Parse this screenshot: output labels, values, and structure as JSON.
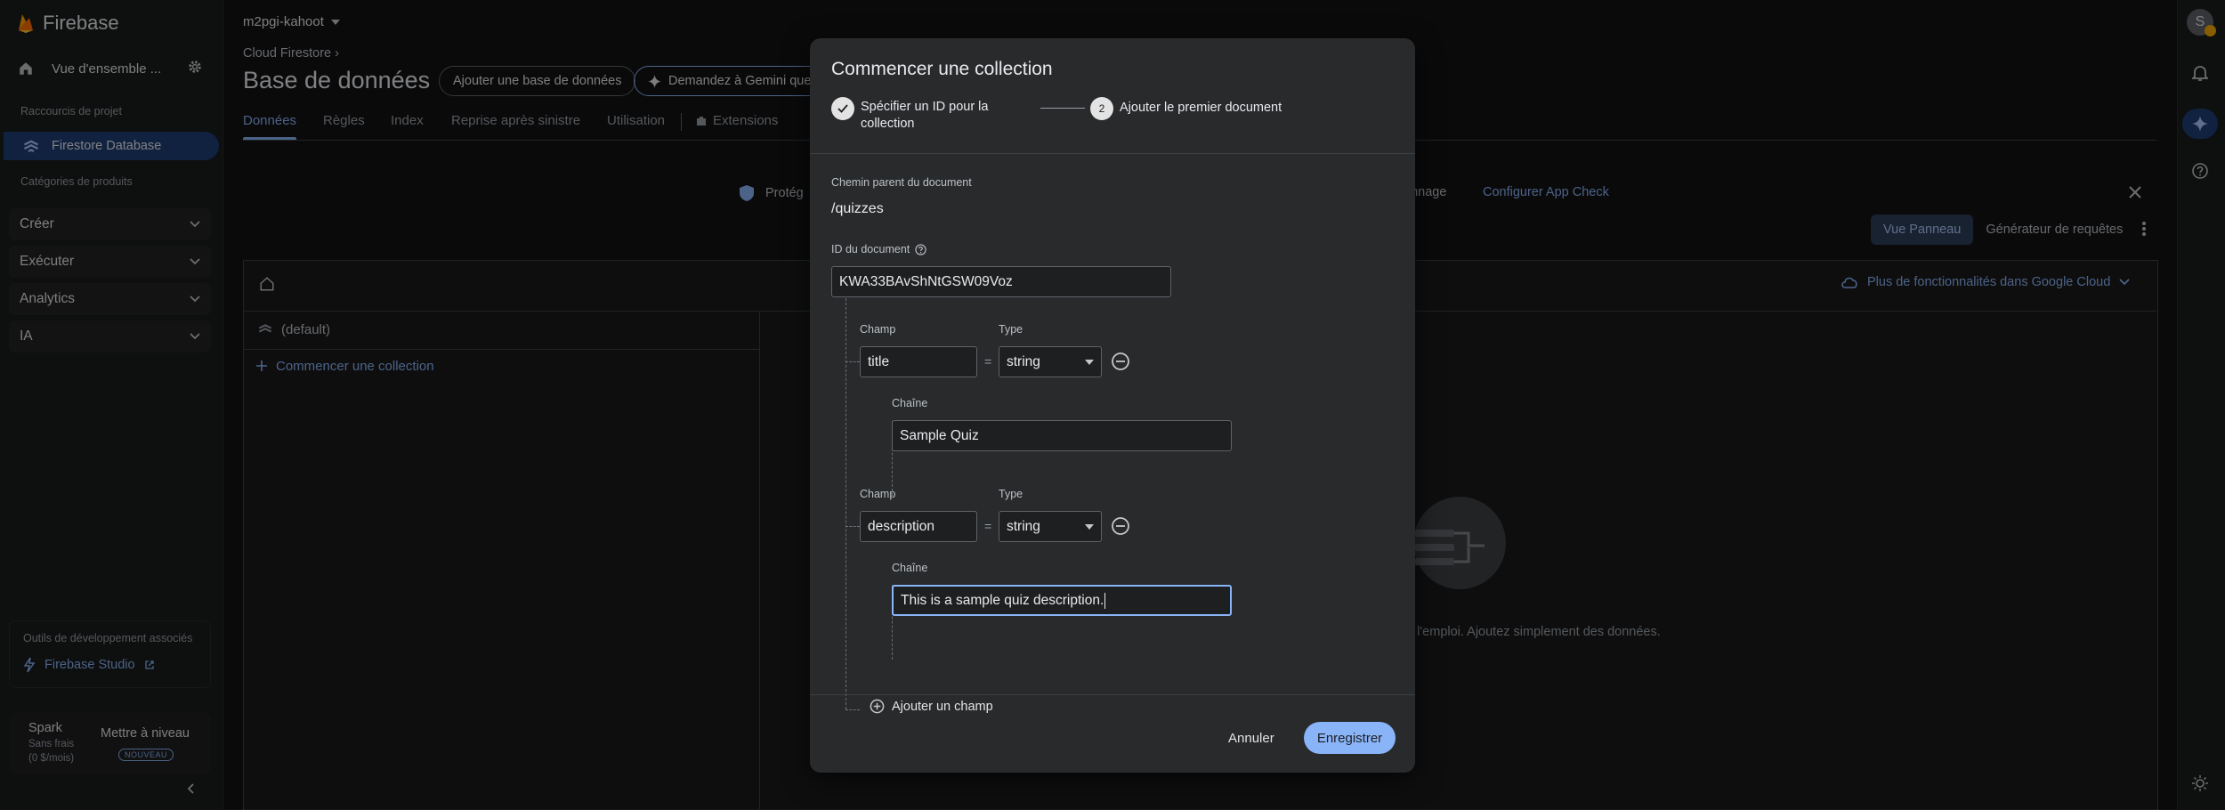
{
  "sidebar": {
    "brand": "Firebase",
    "overview_label": "Vue d'ensemble ...",
    "shortcuts_caption": "Raccourcis de projet",
    "active_item": "Firestore Database",
    "categories_caption": "Catégories de produits",
    "categories": [
      {
        "label": "Créer"
      },
      {
        "label": "Exécuter"
      },
      {
        "label": "Analytics"
      },
      {
        "label": "IA"
      }
    ],
    "dev_tools_caption": "Outils de développement associés",
    "studio_link": "Firebase Studio",
    "plan_name": "Spark",
    "plan_price_line1": "Sans frais",
    "plan_price_line2": "(0 $/mois)",
    "upgrade_label": "Mettre à niveau",
    "new_badge": "NOUVEAU"
  },
  "main": {
    "project": "m2pgi-kahoot",
    "breadcrumb": "Cloud Firestore",
    "breadcrumb_sep": "›",
    "title": "Base de données",
    "add_db_button": "Ajouter une base de données",
    "gemini_button": "Demandez à Gemini que",
    "tabs": [
      "Données",
      "Règles",
      "Index",
      "Reprise après sinistre",
      "Utilisation",
      "Extensions"
    ],
    "banner_prefix": "Protég",
    "banner_suffix": "onnage",
    "banner_link": "Configurer App Check",
    "view_panel": "Vue Panneau",
    "query_builder": "Générateur de requêtes",
    "more_cloud": "Plus de fonctionnalités dans Google Cloud",
    "default_db": "(default)",
    "start_collection": "Commencer une collection",
    "empty_text": "e à l'emploi. Ajoutez simplement des données."
  },
  "dialog": {
    "title": "Commencer une collection",
    "step1_label": "Spécifier un ID pour la collection",
    "step2_number": "2",
    "step2_label": "Ajouter le premier document",
    "parent_path_label": "Chemin parent du document",
    "parent_path": "/quizzes",
    "doc_id_label": "ID du document",
    "doc_id": "KWA33BAvShNtGSW09Voz",
    "fields": [
      {
        "field_label": "Champ",
        "type_label": "Type",
        "name": "title",
        "type": "string",
        "value_label": "Chaîne",
        "value": "Sample Quiz"
      },
      {
        "field_label": "Champ",
        "type_label": "Type",
        "name": "description",
        "type": "string",
        "value_label": "Chaîne",
        "value": "This is a sample quiz description."
      }
    ],
    "equals": "=",
    "add_field": "Ajouter un champ",
    "cancel": "Annuler",
    "save": "Enregistrer"
  },
  "avatar_letter": "S",
  "colors": {
    "accent": "#8ab4f8",
    "active_nav": "#1f3f75",
    "background": "#131314",
    "dialog": "#282a2c"
  }
}
